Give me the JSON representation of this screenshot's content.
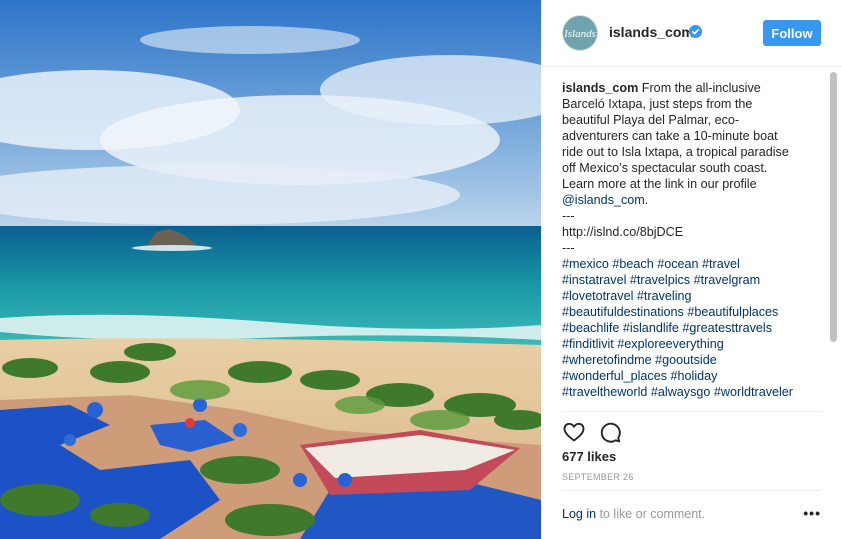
{
  "header": {
    "avatar_text": "Islands",
    "username": "islands_com",
    "follow_label": "Follow"
  },
  "caption": {
    "username": "islands_com",
    "text": "From the all-inclusive Barceló Ixtapa, just steps from the beautiful Playa del Palmar, eco-adventurers can take a 10-minute boat ride out to Isla Ixtapa, a tropical paradise off Mexico’s spectacular south coast. Learn more at the link in our profile",
    "mention": "@islands_com",
    "mention_suffix": ".",
    "separator1": "---",
    "link": "http://islnd.co/8bjDCE",
    "separator2": "---",
    "hashtag_lines": [
      "#mexico #beach #ocean #travel",
      "#instatravel #travelpics #travelgram",
      "#lovetotravel #traveling",
      "#beautifuldestinations #beautifulplaces",
      "#beachlife #islandlife #greatesttravels",
      "#finditlivit #exploreeverything",
      "#wheretofindme #gooutside",
      "#wonderful_places #holiday",
      "#traveltheworld #alwaysgo #worldtraveler"
    ]
  },
  "engagement": {
    "likes": "677 likes",
    "date": "September 26"
  },
  "footer": {
    "login_link": "Log in",
    "login_suffix": " to like or comment.",
    "more": "•••"
  },
  "colors": {
    "accent": "#3897f0",
    "link": "#003569",
    "muted": "#999999"
  },
  "icons": [
    "verified-badge-icon",
    "heart-icon",
    "comment-bubble-icon",
    "more-options-icon"
  ]
}
